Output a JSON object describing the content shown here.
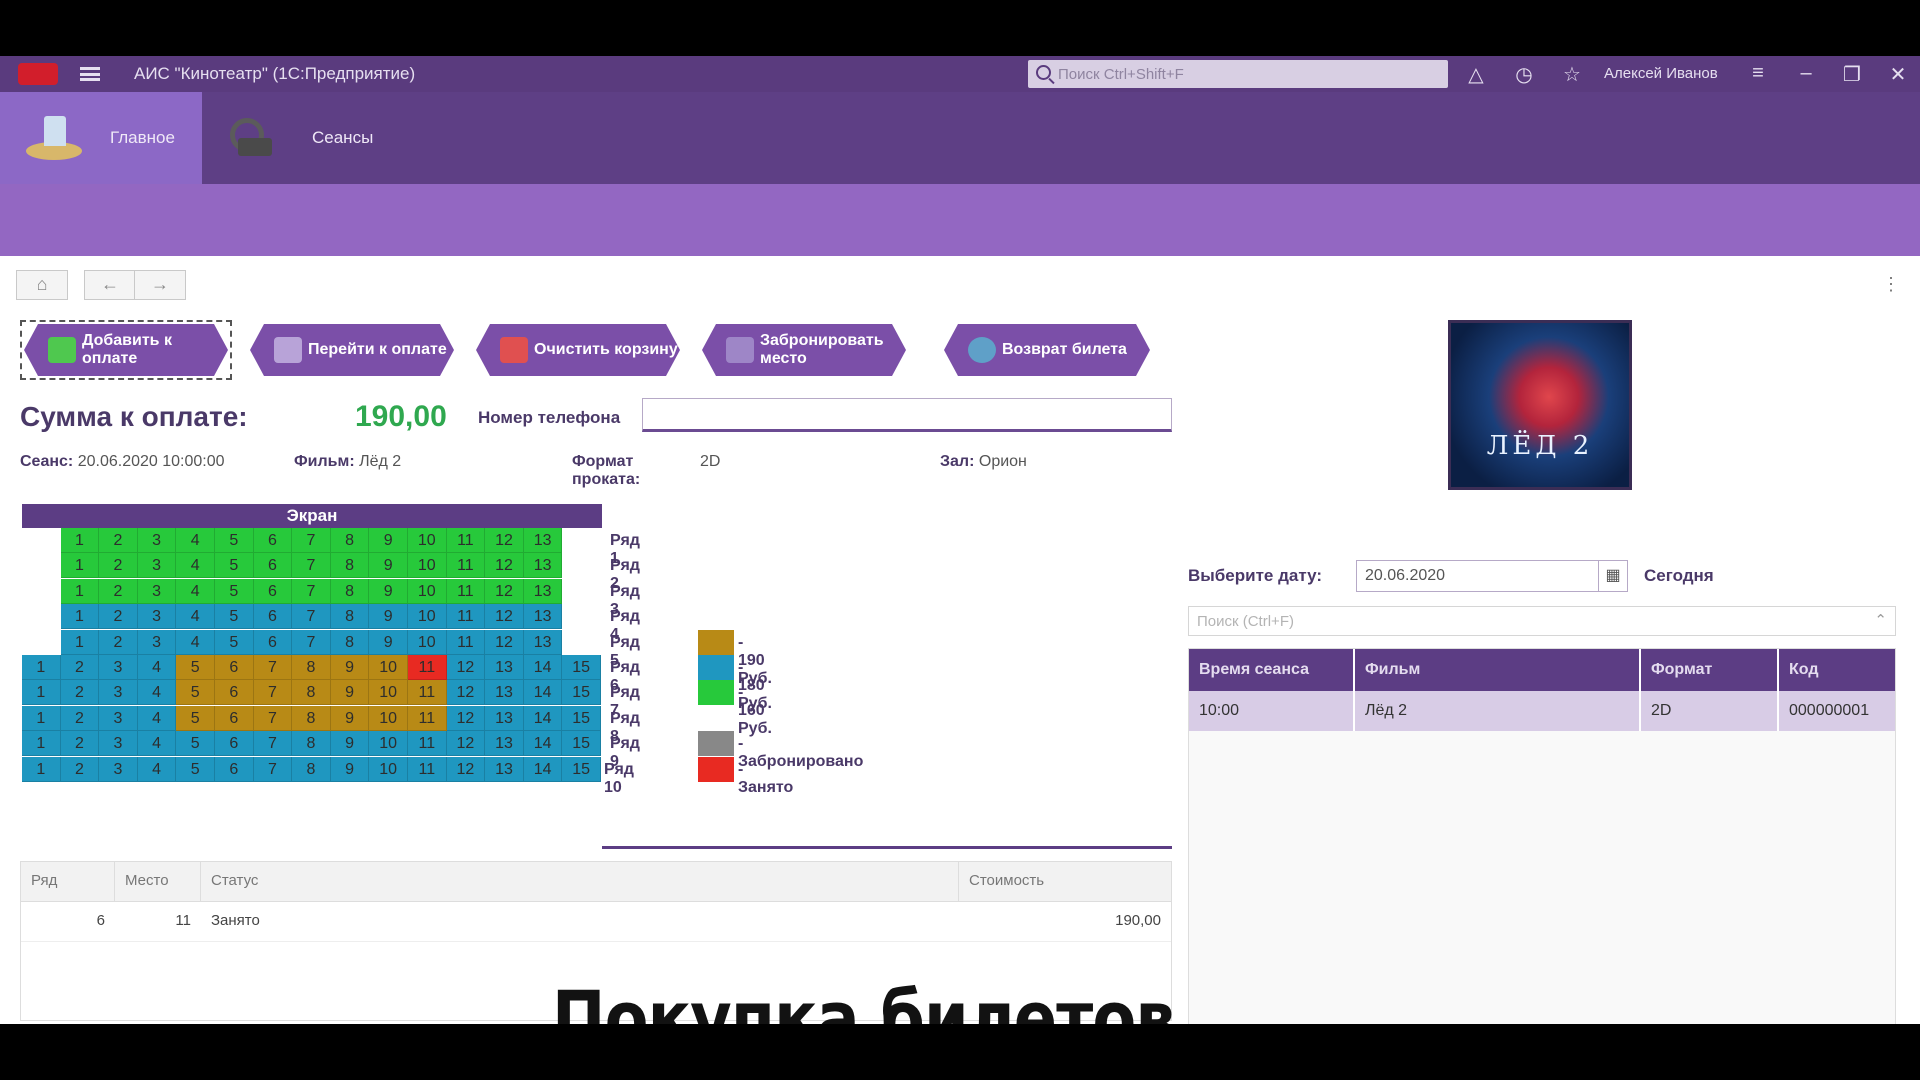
{
  "titlebar": {
    "app_title": "АИС \"Кинотеатр\" (1С:Предприятие)",
    "search_placeholder": "Поиск Ctrl+Shift+F",
    "user_name": "Алексей Иванов"
  },
  "sections": [
    {
      "label": "Главное",
      "icon": "main-section-icon"
    },
    {
      "label": "Сеансы",
      "icon": "film-camera-icon"
    }
  ],
  "nav": {
    "home": "⌂",
    "back": "←",
    "forward": "→",
    "more": "⋮"
  },
  "actions": [
    {
      "label": "Добавить к оплате",
      "icon_color": "#4fc84f"
    },
    {
      "label": "Перейти к оплате",
      "icon_color": "#b8a3d8"
    },
    {
      "label": "Очистить корзину",
      "icon_color": "#e05050"
    },
    {
      "label": "Забронировать место",
      "icon_color": "#9e86c7"
    },
    {
      "label": "Возврат билета",
      "icon_color": "#5fa0c8"
    }
  ],
  "payment": {
    "label": "Сумма к оплате:",
    "value": "190,00",
    "phone_label": "Номер телефона",
    "phone_value": ""
  },
  "session_info": {
    "session_label": "Сеанс:",
    "session_value": "20.06.2020 10:00:00",
    "film_label": "Фильм:",
    "film_value": "Лёд 2",
    "format_label": "Формат проката:",
    "format_value": "2D",
    "hall_label": "Зал:",
    "hall_value": "Орион"
  },
  "hall": {
    "screen_label": "Экран",
    "colors": {
      "green": "#27c93b",
      "blue": "#1f97c0",
      "gold": "#b88a16",
      "red": "#e82a22",
      "gray": "#888888"
    },
    "rows": [
      {
        "label": "Ряд 1",
        "seats": 13,
        "layout": "G13"
      },
      {
        "label": "Ряд 2",
        "seats": 13,
        "layout": "G13"
      },
      {
        "label": "Ряд 3",
        "seats": 13,
        "layout": "G13"
      },
      {
        "label": "Ряд 4",
        "seats": 13,
        "layout": "B13"
      },
      {
        "label": "Ряд 5",
        "seats": 13,
        "layout": "B13"
      },
      {
        "label": "Ряд 6",
        "seats": 15,
        "layout": "W15",
        "taken": [
          11
        ]
      },
      {
        "label": "Ряд 7",
        "seats": 15,
        "layout": "W15"
      },
      {
        "label": "Ряд 8",
        "seats": 15,
        "layout": "W15"
      },
      {
        "label": "Ряд 9",
        "seats": 15,
        "layout": "B15"
      },
      {
        "label": "Ряд 10",
        "seats": 15,
        "layout": "B15"
      }
    ],
    "legend": [
      {
        "color": "#b88a16",
        "text": "- 190 Руб.",
        "row_index": 4
      },
      {
        "color": "#1f97c0",
        "text": "- 180 Руб.",
        "row_index": 5
      },
      {
        "color": "#27c93b",
        "text": "- 160 Руб.",
        "row_index": 6
      },
      {
        "color": "#888888",
        "text": "- Забронировано",
        "row_index": 8
      },
      {
        "color": "#e82a22",
        "text": "- Занято",
        "row_index": 9
      }
    ]
  },
  "tickets": {
    "columns": [
      "Ряд",
      "Место",
      "Статус",
      "Стоимость"
    ],
    "rows": [
      {
        "row": "6",
        "seat": "11",
        "status": "Занято",
        "price": "190,00"
      }
    ]
  },
  "caption": "Покупка билетов",
  "right": {
    "poster_title": "ЛЁД 2",
    "date_label": "Выберите дату:",
    "date_value": "20.06.2020",
    "today_label": "Сегодня",
    "search_placeholder": "Поиск (Ctrl+F)",
    "columns": [
      "Время сеанса",
      "Фильм",
      "Формат",
      "Код"
    ],
    "rows": [
      {
        "time": "10:00",
        "film": "Лёд 2",
        "format": "2D",
        "code": "000000001"
      }
    ]
  }
}
